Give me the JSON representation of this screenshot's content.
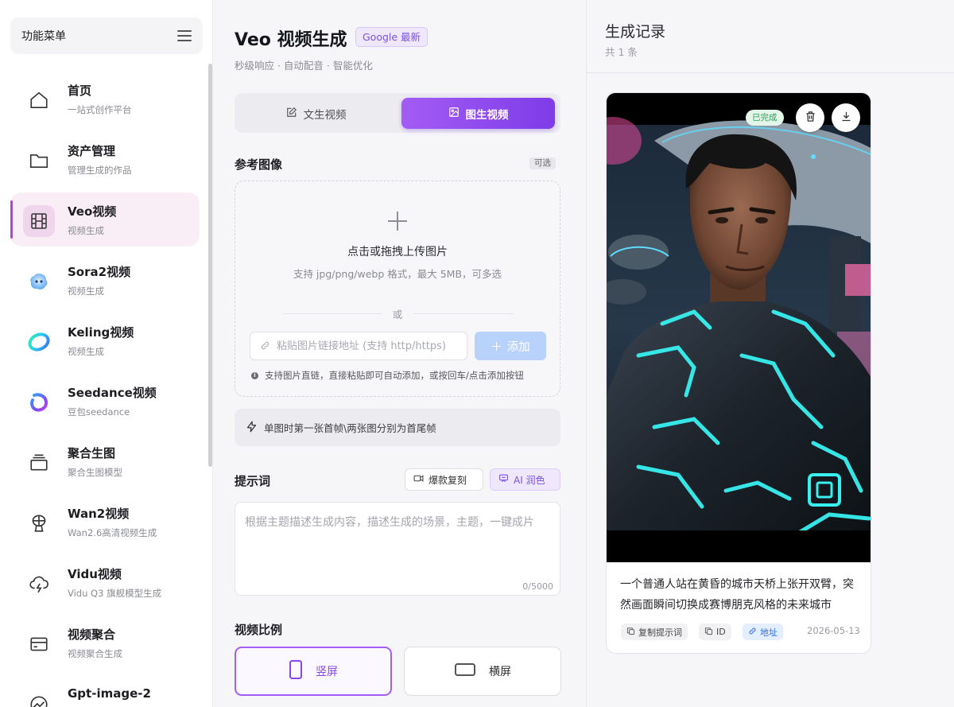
{
  "sidebar": {
    "menu_title": "功能菜单",
    "items": [
      {
        "title": "首页",
        "sub": "一站式创作平台",
        "icon": "home-icon"
      },
      {
        "title": "资产管理",
        "sub": "管理生成的作品",
        "icon": "folder-icon"
      },
      {
        "title": "Veo视频",
        "sub": "视频生成",
        "icon": "film-icon",
        "active": true
      },
      {
        "title": "Sora2视频",
        "sub": "视频生成",
        "icon": "sora-logo-icon"
      },
      {
        "title": "Keling视频",
        "sub": "视频生成",
        "icon": "kling-logo-icon"
      },
      {
        "title": "Seedance视频",
        "sub": "豆包seedance",
        "icon": "seedance-logo-icon"
      },
      {
        "title": "聚合生图",
        "sub": "聚合生图模型",
        "icon": "layers-icon"
      },
      {
        "title": "Wan2视频",
        "sub": "Wan2.6高清视频生成",
        "icon": "wan-icon"
      },
      {
        "title": "Vidu视频",
        "sub": "Vidu Q3 旗舰模型生成",
        "icon": "cloud-bolt-icon"
      },
      {
        "title": "视频聚合",
        "sub": "视频聚合生成",
        "icon": "card-icon"
      },
      {
        "title": "Gpt-image-2",
        "sub": "",
        "icon": "chart-icon"
      }
    ]
  },
  "main": {
    "title": "Veo 视频生成",
    "badge": "Google 最新",
    "subtitle": "秒级响应 · 自动配音 · 智能优化",
    "tabs": [
      {
        "label": "文生视频",
        "active": false
      },
      {
        "label": "图生视频",
        "active": true
      }
    ],
    "reference": {
      "label": "参考图像",
      "optional": "可选",
      "upload_main": "点击或拖拽上传图片",
      "upload_sub": "支持 jpg/png/webp 格式，最大 5MB，可多选",
      "or": "或",
      "url_placeholder": "粘贴图片链接地址 (支持 http/https)",
      "add_label": "添加",
      "hint": "支持图片直链，直接粘贴即可自动添加，或按回车/点击添加按钮"
    },
    "tip": "单图时第一张首帧\\两张图分别为首尾帧",
    "prompt": {
      "label": "提示词",
      "copy_btn": "爆款复刻",
      "ai_btn": "AI 润色",
      "placeholder": "根据主题描述生成内容，描述生成的场景，主题，一键成片",
      "value": "",
      "counter": "0/5000"
    },
    "ratio": {
      "label": "视频比例",
      "portrait": "竖屏",
      "landscape": "横屏",
      "selected": "竖屏"
    }
  },
  "history": {
    "title": "生成记录",
    "count": "共 1 条",
    "items": [
      {
        "status": "已完成",
        "desc": "一个普通人站在黄昏的城市天桥上张开双臂，突然画面瞬间切换成赛博朋克风格的未来城市",
        "copy_label": "复制提示词",
        "id_label": "ID",
        "link_label": "地址",
        "date": "2026-05-13"
      }
    ]
  },
  "colors": {
    "accent": "#8a45ec",
    "accent_light": "#efe8fd",
    "active_nav_bg": "#faeef6",
    "status_green": "#2f9e5a",
    "link_blue": "#2f6fe0"
  }
}
